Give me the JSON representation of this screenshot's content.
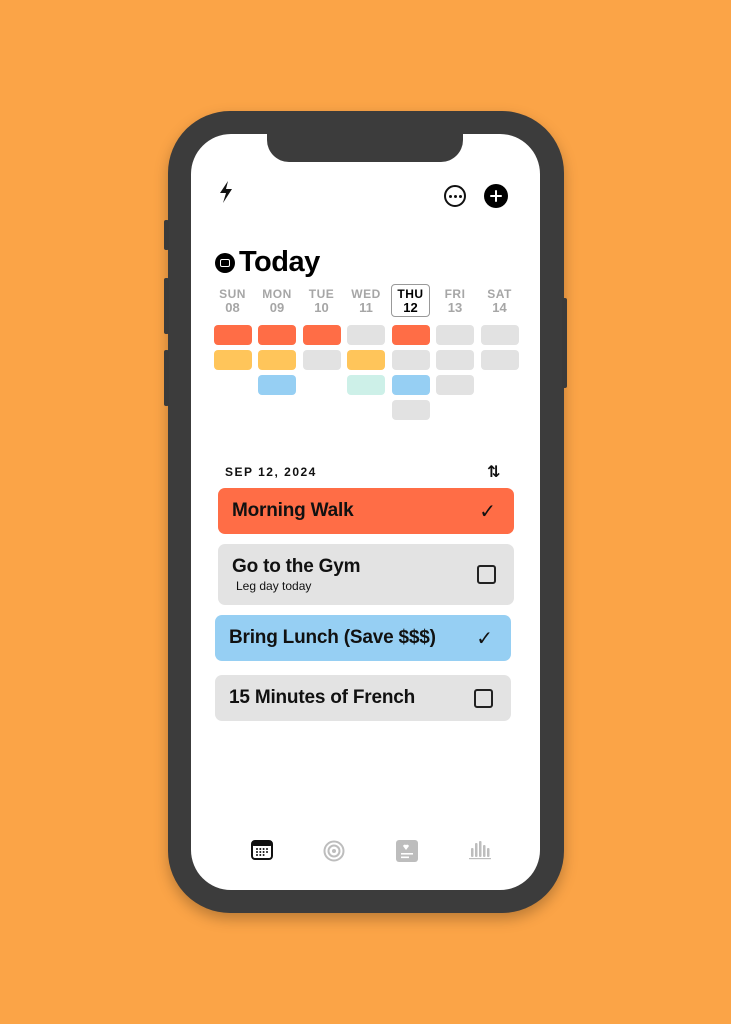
{
  "header": {
    "left_icon": "bolt-icon",
    "right_icons": [
      "more-icon",
      "add-icon"
    ],
    "title": "Today",
    "title_icon": "calendar-circle-icon"
  },
  "week": {
    "days": [
      {
        "name": "SUN",
        "date": "08",
        "today": false,
        "cells": [
          "#FF6D46",
          "#FFC55A",
          null
        ]
      },
      {
        "name": "MON",
        "date": "09",
        "today": false,
        "cells": [
          "#FF6D46",
          "#FFC55A",
          "#96CFF3"
        ]
      },
      {
        "name": "TUE",
        "date": "10",
        "today": false,
        "cells": [
          "#FF6D46",
          "#E2E2E2"
        ]
      },
      {
        "name": "WED",
        "date": "11",
        "today": false,
        "cells": [
          "#E2E2E2",
          "#FFC55A",
          "#CDF0E8"
        ]
      },
      {
        "name": "THU",
        "date": "12",
        "today": true,
        "cells": [
          "#FF6D46",
          "#E2E2E2",
          "#96CFF3",
          "#E2E2E2"
        ]
      },
      {
        "name": "FRI",
        "date": "13",
        "today": false,
        "cells": [
          "#E2E2E2",
          "#E2E2E2",
          "#E2E2E2"
        ]
      },
      {
        "name": "SAT",
        "date": "14",
        "today": false,
        "cells": [
          "#E2E2E2",
          "#E2E2E2"
        ]
      }
    ]
  },
  "list": {
    "date_label": "SEP 12, 2024",
    "sort_icon": "⇅",
    "tasks": [
      {
        "title": "Morning Walk",
        "subtitle": "",
        "done": true,
        "color": "#FF6D46"
      },
      {
        "title": "Go to the Gym",
        "subtitle": "Leg day today",
        "done": false,
        "color": "#E3E3E3"
      },
      {
        "title": "Bring Lunch (Save $$$)",
        "subtitle": "",
        "done": true,
        "color": "#96CFF3"
      },
      {
        "title": "15 Minutes of French",
        "subtitle": "",
        "done": false,
        "color": "#E3E3E3"
      }
    ]
  },
  "tabbar": {
    "tabs": [
      {
        "icon": "calendar-icon",
        "active": true
      },
      {
        "icon": "target-icon",
        "active": false
      },
      {
        "icon": "journal-heart-icon",
        "active": false
      },
      {
        "icon": "bar-chart-icon",
        "active": false
      }
    ]
  },
  "colors": {
    "background": "#FBA447",
    "accent_red": "#FF6D46",
    "accent_yellow": "#FFC55A",
    "accent_blue": "#96CFF3",
    "accent_mint": "#CDF0E8",
    "empty": "#E2E2E2"
  }
}
